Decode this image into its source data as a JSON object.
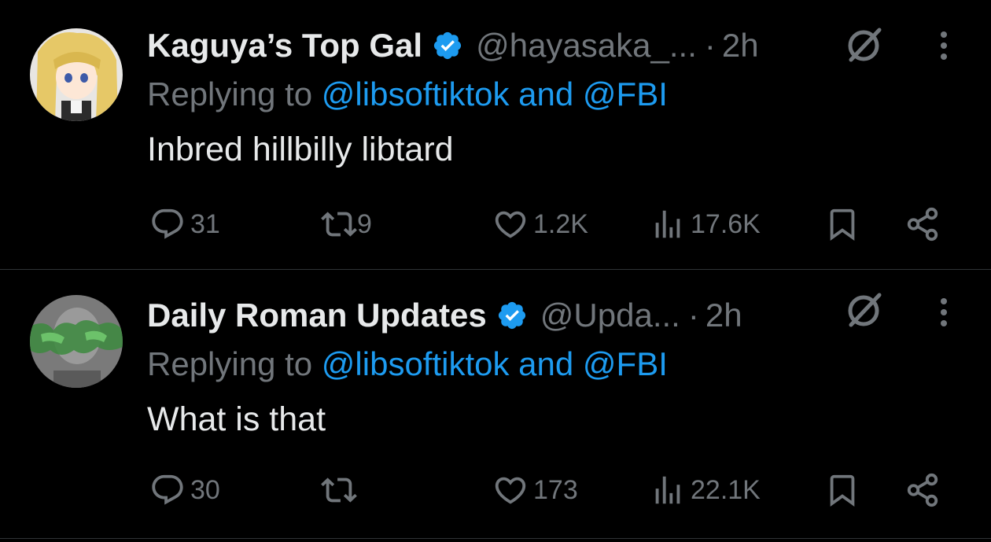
{
  "tweets": [
    {
      "author_name": "Kaguya’s Top Gal",
      "handle": "@hayasaka_...",
      "separator": "·",
      "time": "2h",
      "reply_prefix": "Replying to ",
      "reply_targets": "@libsoftiktok and @FBI",
      "text": "Inbred hillbilly libtard",
      "replies": "31",
      "reposts": "9",
      "likes": "1.2K",
      "views": "17.6K"
    },
    {
      "author_name": "Daily Roman Updates",
      "handle": "@Upda...",
      "separator": "·",
      "time": "2h",
      "reply_prefix": "Replying to ",
      "reply_targets": "@libsoftiktok and @FBI",
      "text": "What is that",
      "replies": "30",
      "reposts": "",
      "likes": "173",
      "views": "22.1K"
    }
  ],
  "colors": {
    "background": "#000000",
    "primary_text": "#e7e9ea",
    "secondary_text": "#71767b",
    "accent": "#1d9bf0",
    "divider": "#2f3336"
  },
  "icons": [
    "verified-badge-icon",
    "grok-icon",
    "more-icon",
    "reply-icon",
    "repost-icon",
    "like-icon",
    "views-icon",
    "bookmark-icon",
    "share-icon"
  ]
}
